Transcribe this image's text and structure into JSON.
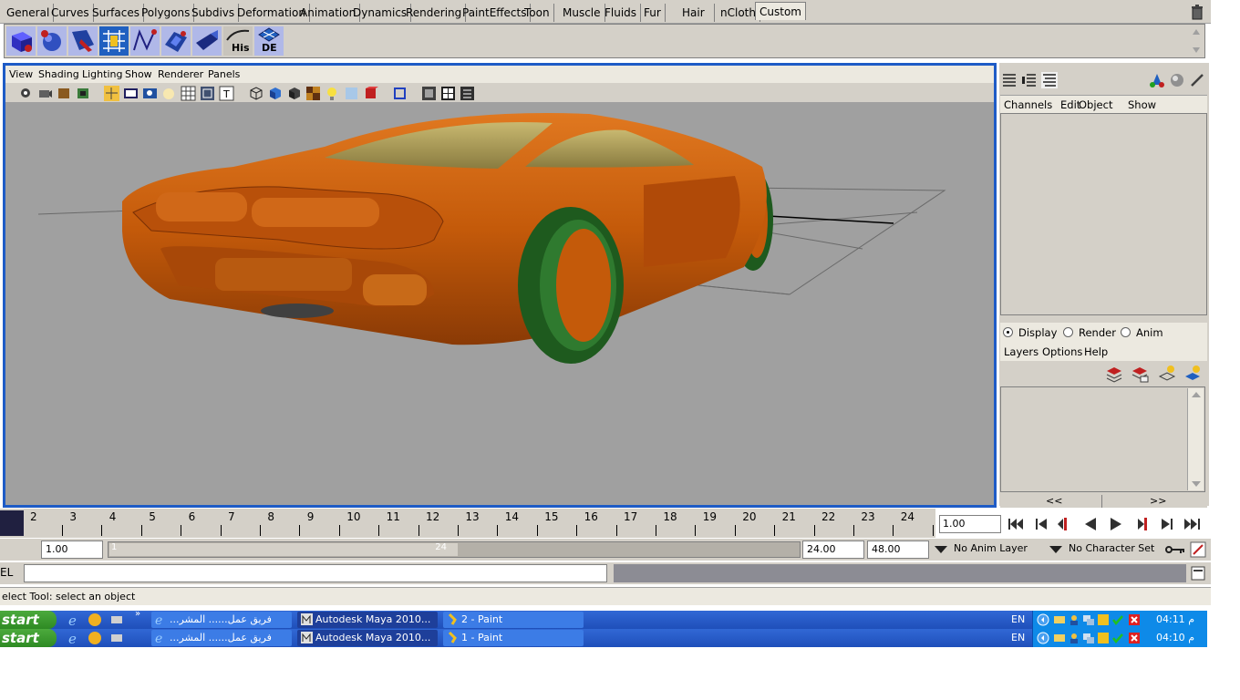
{
  "shelf_tabs": [
    "General",
    "Curves",
    "Surfaces",
    "Polygons",
    "Subdivs",
    "Deformation",
    "Animation",
    "Dynamics",
    "Rendering",
    "PaintEffects",
    "Toon",
    "Muscle",
    "Fluids",
    "Fur",
    "Hair",
    "nCloth",
    "Custom"
  ],
  "shelf_tab_active": "Custom",
  "shelf_buttons": [
    {
      "icon": "polygon-cube-icon",
      "label": ""
    },
    {
      "icon": "polygon-sphere-icon",
      "label": ""
    },
    {
      "icon": "select-tool-icon",
      "label": ""
    },
    {
      "icon": "uv-editor-icon",
      "label": ""
    },
    {
      "icon": "curve-tool-icon",
      "label": ""
    },
    {
      "icon": "extrude-icon",
      "label": ""
    },
    {
      "icon": "plane-icon",
      "label": ""
    },
    {
      "icon": "history-icon",
      "label": "His"
    },
    {
      "icon": "delete-history-icon",
      "label": "DE"
    }
  ],
  "panel_menu": [
    "View",
    "Shading",
    "Lighting",
    "Show",
    "Renderer",
    "Panels"
  ],
  "channel_box": {
    "menu": [
      "Channels",
      "Edit",
      "Object",
      "Show"
    ]
  },
  "layer_editor": {
    "modes": [
      "Display",
      "Render",
      "Anim"
    ],
    "selected_mode": "Display",
    "menu": [
      "Layers",
      "Options",
      "Help"
    ],
    "pager_prev": "<<",
    "pager_next": ">>"
  },
  "time_slider": {
    "ticks": [
      "2",
      "3",
      "4",
      "5",
      "6",
      "7",
      "8",
      "9",
      "10",
      "11",
      "12",
      "13",
      "14",
      "15",
      "16",
      "17",
      "18",
      "19",
      "20",
      "21",
      "22",
      "23",
      "24"
    ],
    "current_frame": "1.00"
  },
  "range_slider": {
    "start_time": "1.00",
    "range_start_label": "1",
    "range_end_label": "24",
    "end_time": "24.00",
    "playback_end": "48.00",
    "anim_layer": "No Anim Layer",
    "character_set": "No Character Set"
  },
  "command_line": {
    "label": "EL",
    "value": ""
  },
  "help_line": "elect Tool: select an object",
  "taskbars": [
    {
      "start_label": "start",
      "tasks": [
        "...فريق عمل...... المشر",
        "Autodesk Maya 2010...",
        "2 - Paint"
      ],
      "active_task": 1,
      "language": "EN",
      "clock": "04:11 م"
    },
    {
      "start_label": "start",
      "tasks": [
        "...فريق عمل...... المشر",
        "Autodesk Maya 2010...",
        "1 - Paint"
      ],
      "active_task": 1,
      "language": "EN",
      "clock": "04:10 م"
    }
  ],
  "colors": {
    "maya_panel": "#d4d0c8",
    "viewport_bg": "#a0a0a0",
    "active_panel_border": "#1e5bc6",
    "car_body": "#c45a0a",
    "car_glass": "#a89a50",
    "tire": "#2a6a2a",
    "taskbar_blue": "#2558c8",
    "start_green": "#3a9a30"
  }
}
